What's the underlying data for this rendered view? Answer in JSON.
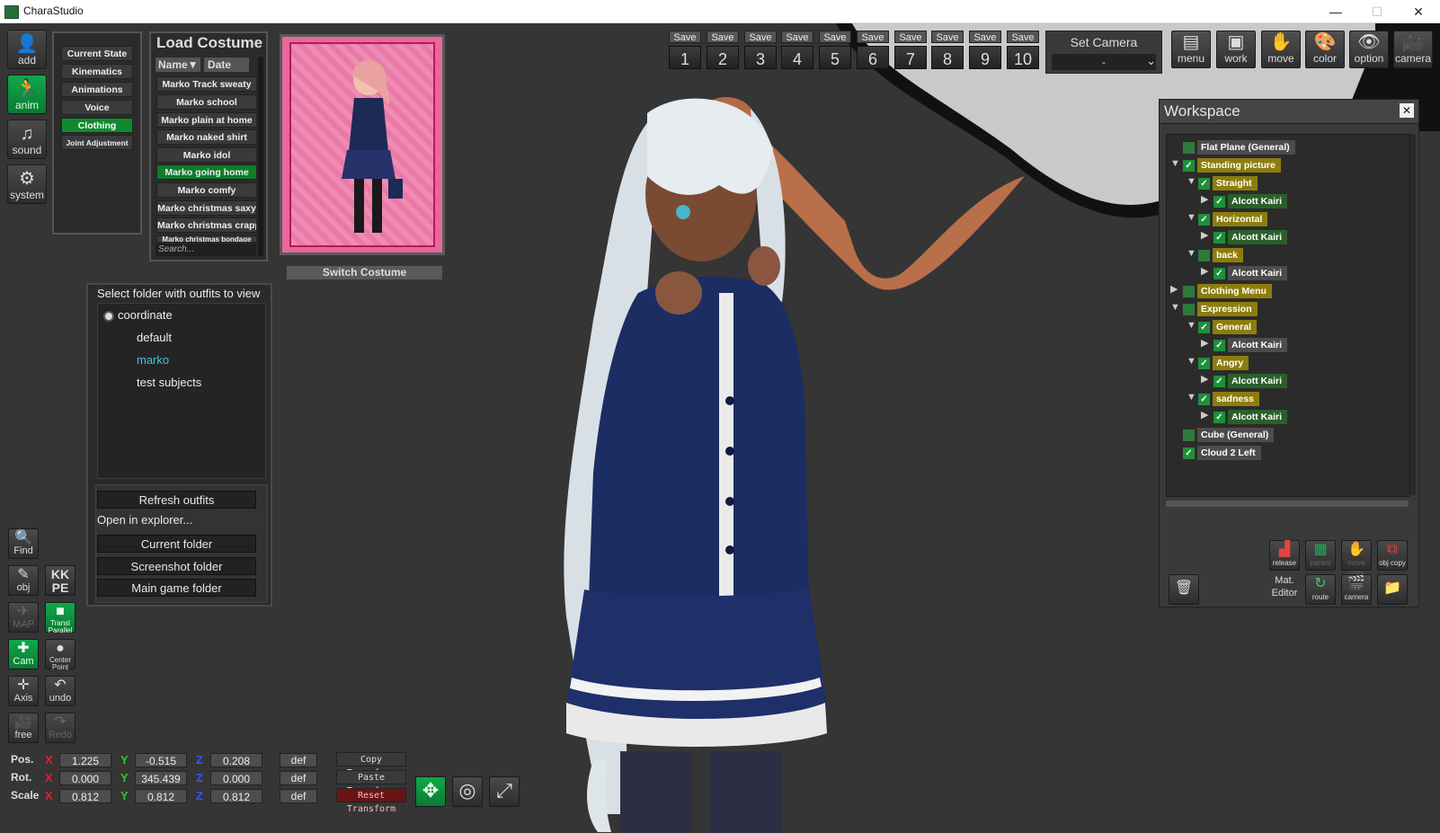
{
  "window": {
    "title": "CharaStudio",
    "minimize": "—",
    "maximize": "☐",
    "close": "✕"
  },
  "left_toolbar": [
    {
      "name": "add",
      "label": "add",
      "glyph": "👤"
    },
    {
      "name": "anim",
      "label": "anim",
      "glyph": "🏃"
    },
    {
      "name": "sound",
      "label": "sound",
      "glyph": "♫"
    },
    {
      "name": "system",
      "label": "system",
      "glyph": "⚙"
    }
  ],
  "menu_list": {
    "items": [
      "Current State",
      "Kinematics",
      "Animations",
      "Voice",
      "Clothing",
      "Joint Adjustment"
    ],
    "active": "Clothing"
  },
  "load_costume": {
    "title": "Load Costume",
    "sort_name": "Name▼",
    "sort_date": "Date",
    "items": [
      "Marko Track sweaty",
      "Marko school",
      "Marko plain at home",
      "Marko naked shirt",
      "Marko idol",
      "Marko going home",
      "Marko comfy",
      "Marko christmas saxy",
      "Marko christmas crapp",
      "Marko christmas bondage"
    ],
    "active": "Marko going home",
    "search_placeholder": "Search..."
  },
  "switch_costume": "Switch Costume",
  "folder_dialog": {
    "title": "Select folder with outfits to view",
    "root": "coordinate",
    "folders": [
      "default",
      "marko",
      "test subjects"
    ],
    "selected": "marko",
    "refresh": "Refresh outfits",
    "open_in": "Open in explorer...",
    "current": "Current folder",
    "screenshot": "Screenshot folder",
    "main": "Main game folder"
  },
  "save_slots": {
    "label": "Save",
    "numbers": [
      "1",
      "2",
      "3",
      "4",
      "5",
      "6",
      "7",
      "8",
      "9",
      "10"
    ]
  },
  "set_camera": {
    "label": "Set Camera",
    "value": "-"
  },
  "top_buttons": [
    {
      "name": "menu",
      "label": "menu",
      "glyph": "▤"
    },
    {
      "name": "work",
      "label": "work",
      "glyph": "▣"
    },
    {
      "name": "move",
      "label": "move",
      "glyph": "✋"
    },
    {
      "name": "color",
      "label": "color",
      "glyph": "🎨"
    },
    {
      "name": "option",
      "label": "option",
      "glyph": "👁"
    },
    {
      "name": "camera",
      "label": "camera",
      "glyph": "🎥"
    }
  ],
  "workspace": {
    "title": "Workspace",
    "close": "✕",
    "tree": [
      {
        "label": "Flat Plane (General)",
        "indent": 0,
        "toggle": "",
        "check": false,
        "style": "ws-gray"
      },
      {
        "label": "Standing picture",
        "indent": 0,
        "toggle": "▼",
        "check": true,
        "style": "ws-olive"
      },
      {
        "label": "Straight",
        "indent": 1,
        "toggle": "▼",
        "check": true,
        "style": "ws-olive"
      },
      {
        "label": "Alcott Kairi",
        "indent": 2,
        "toggle": "▶",
        "check": true,
        "style": "ws-green"
      },
      {
        "label": "Horizontal",
        "indent": 1,
        "toggle": "▼",
        "check": true,
        "style": "ws-olive"
      },
      {
        "label": "Alcott Kairi",
        "indent": 2,
        "toggle": "▶",
        "check": true,
        "style": "ws-green"
      },
      {
        "label": "back",
        "indent": 1,
        "toggle": "▼",
        "check": false,
        "style": "ws-olive"
      },
      {
        "label": "Alcott Kairi",
        "indent": 2,
        "toggle": "▶",
        "check": true,
        "style": "ws-gray"
      },
      {
        "label": "Clothing Menu",
        "indent": 0,
        "toggle": "▶",
        "check": false,
        "style": "ws-olive"
      },
      {
        "label": "Expression",
        "indent": 0,
        "toggle": "▼",
        "check": false,
        "style": "ws-olive"
      },
      {
        "label": "General",
        "indent": 1,
        "toggle": "▼",
        "check": true,
        "style": "ws-olive"
      },
      {
        "label": "Alcott Kairi",
        "indent": 2,
        "toggle": "▶",
        "check": true,
        "style": "ws-gray"
      },
      {
        "label": "Angry",
        "indent": 1,
        "toggle": "▼",
        "check": true,
        "style": "ws-olive"
      },
      {
        "label": "Alcott Kairi",
        "indent": 2,
        "toggle": "▶",
        "check": true,
        "style": "ws-green"
      },
      {
        "label": "sadness",
        "indent": 1,
        "toggle": "▼",
        "check": true,
        "style": "ws-olive"
      },
      {
        "label": "Alcott Kairi",
        "indent": 2,
        "toggle": "▶",
        "check": true,
        "style": "ws-green"
      },
      {
        "label": "Cube (General)",
        "indent": 0,
        "toggle": "",
        "check": false,
        "style": "ws-gray"
      },
      {
        "label": "Cloud 2 Left",
        "indent": 0,
        "toggle": "",
        "check": true,
        "style": "ws-gray"
      }
    ],
    "buttons": {
      "release": "release",
      "parent": "parent",
      "movecopy": "move copy",
      "objcopy": "obj copy",
      "mat_editor": "Mat. Editor",
      "route": "route",
      "camera": "camera"
    }
  },
  "left_small_tools": [
    {
      "name": "find",
      "label": "Find",
      "glyph": "🔍",
      "state": "normal"
    },
    {
      "name": "obj",
      "label": "obj",
      "glyph": "✎",
      "state": "normal"
    },
    {
      "name": "kkpe",
      "label": "KK PE",
      "glyph": "",
      "state": "normal"
    },
    {
      "name": "map",
      "label": "MAP",
      "glyph": "✈",
      "state": "dim"
    },
    {
      "name": "transl-parallel",
      "label": "Transl Parallel",
      "glyph": "■",
      "state": "green"
    },
    {
      "name": "cam",
      "label": "Cam",
      "glyph": "✚",
      "state": "green"
    },
    {
      "name": "center-point",
      "label": "Center Point",
      "glyph": "●",
      "state": "normal"
    },
    {
      "name": "axis",
      "label": "Axis",
      "glyph": "✛",
      "state": "normal"
    },
    {
      "name": "undo",
      "label": "undo",
      "glyph": "↶",
      "state": "normal"
    },
    {
      "name": "free",
      "label": "free",
      "glyph": "🎥",
      "state": "normal"
    },
    {
      "name": "redo",
      "label": "Redo",
      "glyph": "↷",
      "state": "dim"
    }
  ],
  "transform": {
    "pos": {
      "label": "Pos.",
      "x": "1.225",
      "y": "-0.515",
      "z": "0.208"
    },
    "rot": {
      "label": "Rot.",
      "x": "0.000",
      "y": "345.439",
      "z": "0.000"
    },
    "scale": {
      "label": "Scale",
      "x": "0.812",
      "y": "0.812",
      "z": "0.812"
    },
    "axis_x": "X",
    "axis_y": "Y",
    "axis_z": "Z",
    "def": "def",
    "copy": "Copy Transform",
    "paste": "Paste Transform",
    "reset": "Reset Transform"
  },
  "colors": {
    "accent_green": "#0f8a2e",
    "olive": "#8c7d0c",
    "reset_red": "#7a1515"
  }
}
